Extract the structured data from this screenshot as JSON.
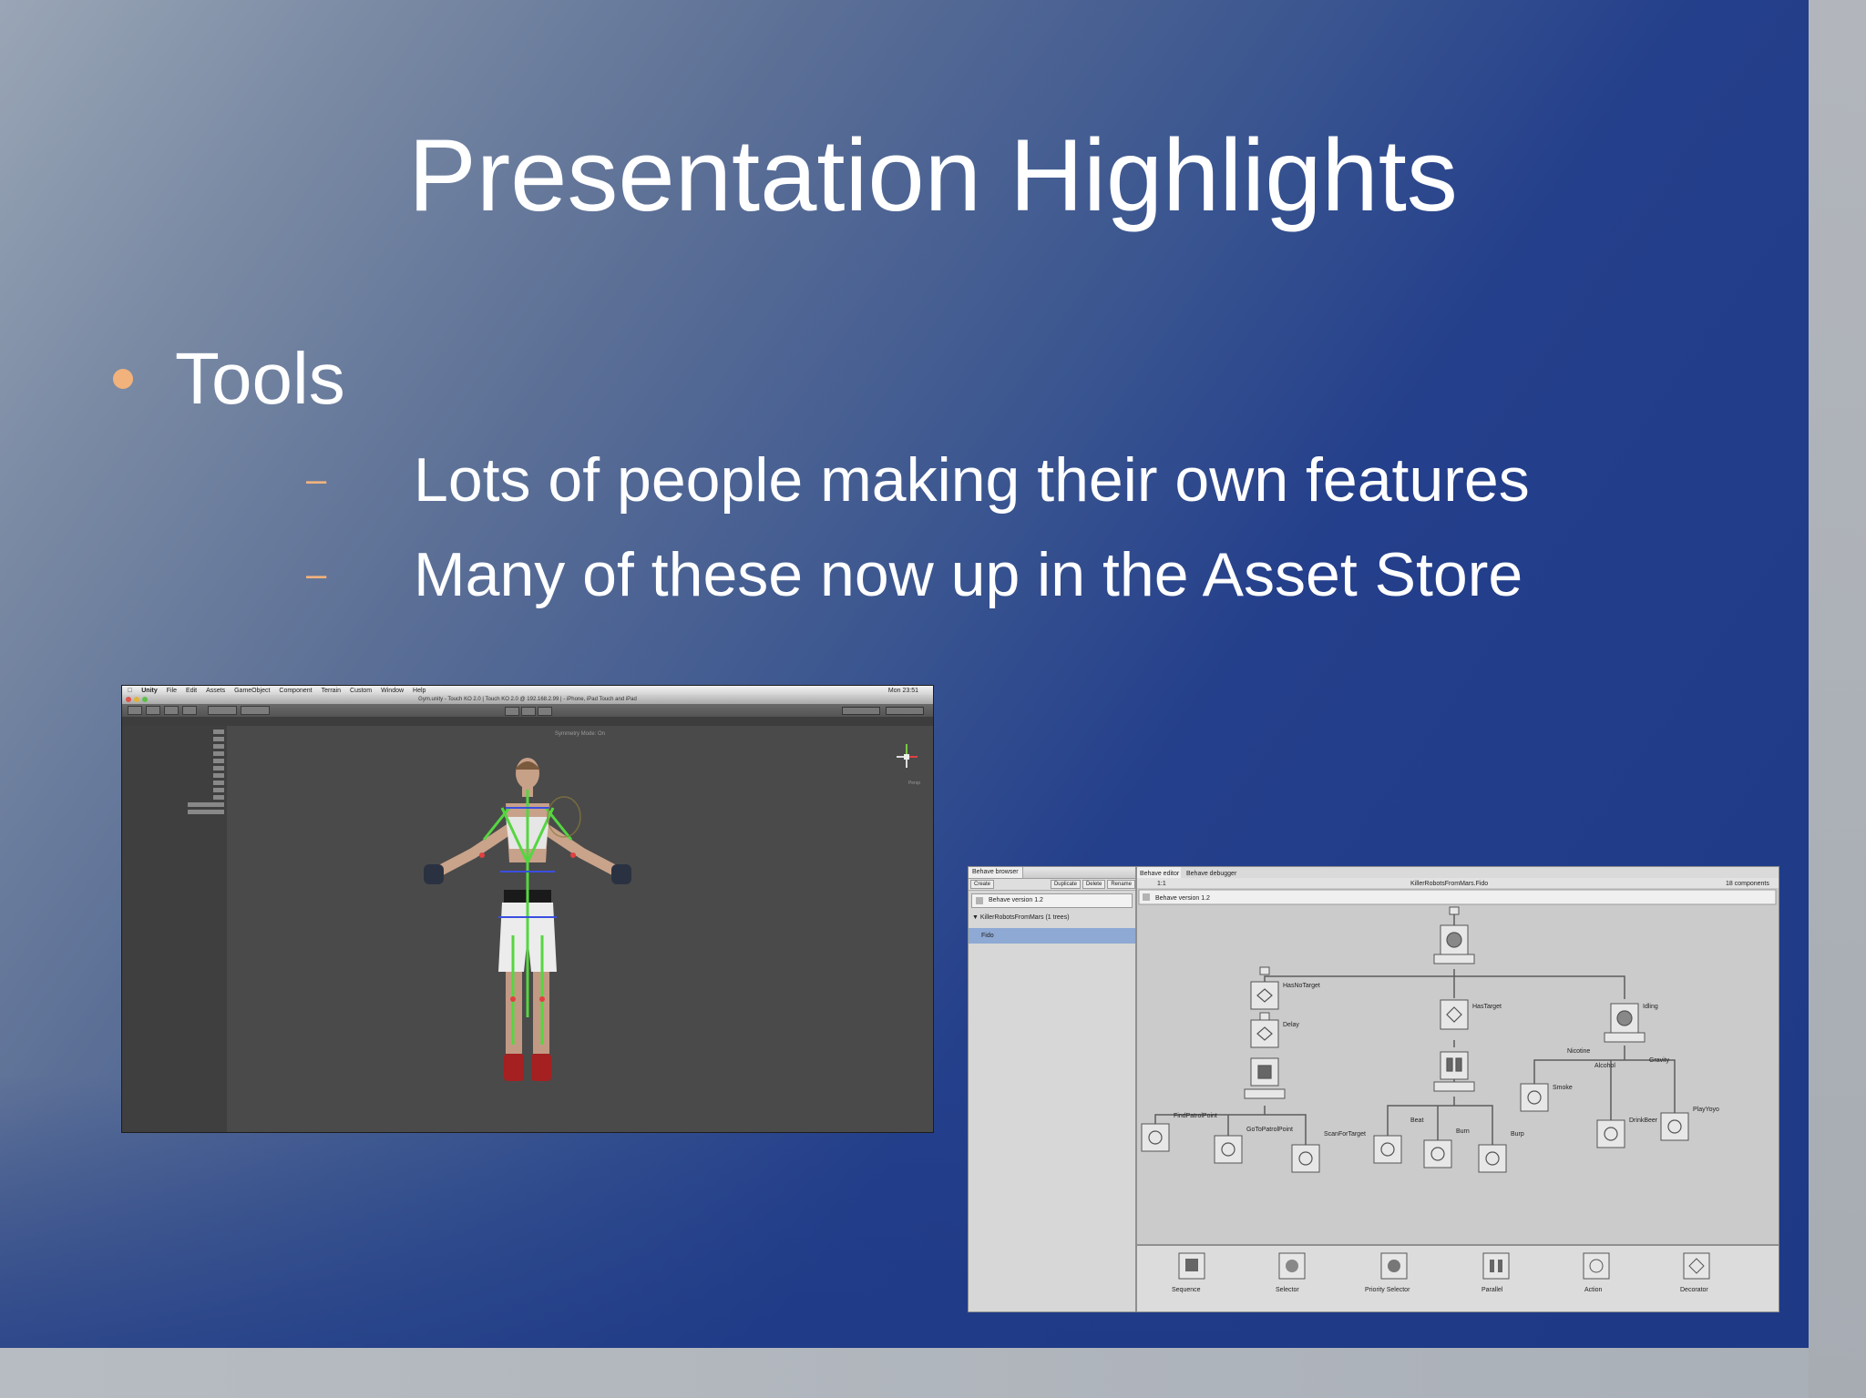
{
  "slide": {
    "title": "Presentation Highlights",
    "bullet": "Tools",
    "subbullets": [
      "Lots of people making their own features",
      "Many of these now up in the Asset Store"
    ],
    "dash": "–"
  },
  "unity": {
    "menubar": [
      "Unity",
      "File",
      "Edit",
      "Assets",
      "GameObject",
      "Component",
      "Terrain",
      "Custom",
      "Window",
      "Help"
    ],
    "clock": "Mon 23:51",
    "window_title": "Gym.unity - Touch KO 2.0 | Touch KO 2.0 @ 192.168.2.99 | - iPhone, iPad Touch and iPad",
    "viewport_label": "Symmetry Mode: On",
    "gizmo_label": "Persp"
  },
  "behave": {
    "left_tabs": [
      "Behave browser"
    ],
    "left_buttons": [
      "Create",
      "Duplicate",
      "Delete",
      "Rename"
    ],
    "version_left": "Behave version 1.2",
    "tree_group": "KillerRobotsFromMars (1 trees)",
    "selected_tree": "Fido",
    "right_tabs": [
      "Behave editor",
      "Behave debugger"
    ],
    "zoom_label": "1:1",
    "canvas_title": "KillerRobotsFromMars.Fido",
    "component_count": "18 components",
    "version_right": "Behave version 1.2",
    "node_labels": {
      "has_no_target": "HasNoTarget",
      "delay": "Delay",
      "has_target": "HasTarget",
      "idling": "Idling",
      "find_patrol": "FindPatrolPoint",
      "goto_patrol": "GoToPatrolPoint",
      "scan": "ScanForTarget",
      "beat": "Beat",
      "burn": "Burn",
      "burp": "Burp",
      "smoke": "Smoke",
      "nicotine": "Nicotine",
      "alcohol": "Alcohol",
      "gravity": "Gravity",
      "drink_beer": "DrinkBeer",
      "play_yoyo": "PlayYoyo"
    },
    "palette": [
      "Sequence",
      "Selector",
      "Priority Selector",
      "Parallel",
      "Action",
      "Decorator"
    ]
  }
}
